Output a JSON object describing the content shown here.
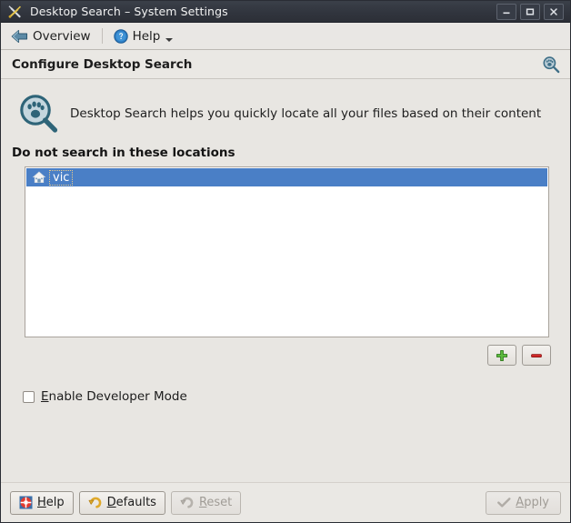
{
  "window": {
    "title": "Desktop Search – System Settings",
    "icon": "tools-icon",
    "controls": {
      "minimize": "minimize-button",
      "maximize": "maximize-button",
      "close": "close-button"
    }
  },
  "toolbar": {
    "overview_label": "Overview",
    "overview_icon": "back-arrow-icon",
    "help_label": "Help",
    "help_icon": "help-circle-icon",
    "help_has_menu": true
  },
  "header": {
    "title": "Configure Desktop Search",
    "icon": "search-paw-magnifier-icon"
  },
  "intro": {
    "icon": "desktop-search-magnifier-icon",
    "text": "Desktop Search helps you quickly locate all your files based on their content"
  },
  "locations": {
    "section_title": "Do not search in these locations",
    "items": [
      {
        "label": "vic",
        "icon": "home-folder-icon",
        "selected": true,
        "focused": true
      }
    ],
    "add_button": {
      "name": "add-location-button",
      "icon": "plus-icon"
    },
    "remove_button": {
      "name": "remove-location-button",
      "icon": "minus-icon"
    }
  },
  "options": {
    "developer_mode": {
      "label_before": "E",
      "label_after": "nable Developer Mode",
      "checked": false
    }
  },
  "footer": {
    "help": {
      "label": "Help",
      "accel": "H",
      "icon": "help-lifering-icon",
      "enabled": true
    },
    "defaults": {
      "label": "Defaults",
      "accel": "D",
      "icon": "undo-arrow-icon",
      "enabled": true
    },
    "reset": {
      "label": "Reset",
      "accel": "R",
      "icon": "undo-arrow-gray-icon",
      "enabled": false
    },
    "apply": {
      "label": "Apply",
      "accel": "A",
      "icon": "checkmark-icon",
      "enabled": false
    }
  },
  "colors": {
    "titlebar": "#31353e",
    "background": "#e8e6e2",
    "selection": "#4a7fc6",
    "accent_blue": "#2b6ca3",
    "add_green": "#4caf36",
    "remove_red": "#cc2222"
  }
}
